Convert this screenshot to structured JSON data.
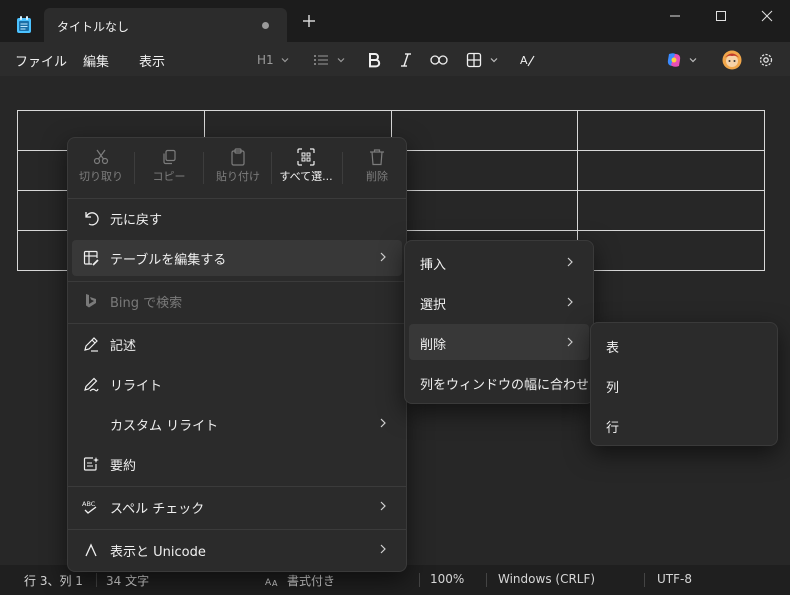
{
  "tab": {
    "title": "タイトルなし"
  },
  "menu": {
    "file": "ファイル",
    "edit": "編集",
    "view": "表示"
  },
  "toolbar": {
    "heading": "H1"
  },
  "context_menu": {
    "toolbar": [
      {
        "label": "切り取り",
        "icon": "cut-icon",
        "enabled": false
      },
      {
        "label": "コピー",
        "icon": "copy-icon",
        "enabled": false
      },
      {
        "label": "貼り付け",
        "icon": "paste-icon",
        "enabled": false
      },
      {
        "label": "すべて選...",
        "icon": "select-all-icon",
        "enabled": true
      },
      {
        "label": "削除",
        "icon": "delete-icon",
        "enabled": false
      }
    ],
    "items": {
      "undo": "元に戻す",
      "edit_table": "テーブルを編集する",
      "bing_search": "Bing で検索",
      "write": "記述",
      "rewrite": "リライト",
      "custom_rewrite": "カスタム リライト",
      "summarize": "要約",
      "spell_check": "スペル チェック",
      "unicode": "表示と Unicode"
    }
  },
  "submenu_table": {
    "insert": "挿入",
    "select": "選択",
    "delete": "削除",
    "fit_columns": "列をウィンドウの幅に合わせる"
  },
  "submenu_delete": {
    "table": "表",
    "column": "列",
    "row": "行"
  },
  "status": {
    "position": "行 3、列 1",
    "chars": "34 文字",
    "format": "書式付き",
    "zoom": "100%",
    "line_ending": "Windows (CRLF)",
    "encoding": "UTF-8"
  },
  "colors": {
    "accent": "#4cc2ff",
    "menu_bg": "#2b2b2b",
    "highlight": "#383838"
  }
}
